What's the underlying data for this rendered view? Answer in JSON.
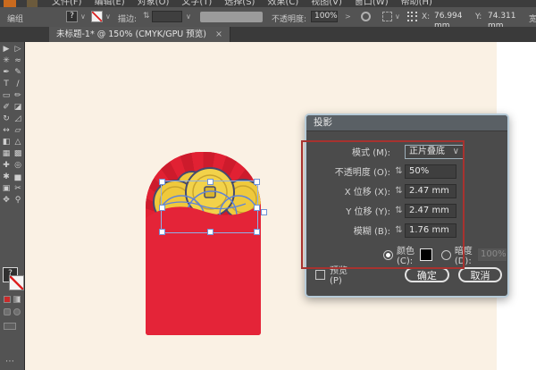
{
  "menu": {
    "items": [
      "文件(F)",
      "编辑(E)",
      "对象(O)",
      "文字(T)",
      "选择(S)",
      "效果(C)",
      "视图(V)",
      "窗口(W)",
      "帮助(H)"
    ]
  },
  "control_bar": {
    "group_label": "编组",
    "fill_mark": "?",
    "stroke_label": "描边:",
    "opacity_label": "不透明度:",
    "opacity_value": "100%",
    "opacity_more": ">",
    "x_label": "X:",
    "x_value": "76.994 mm",
    "y_label": "Y:",
    "y_value": "74.311 mm",
    "width_label": "宽:"
  },
  "tab_bar": {
    "tab_title": "未标题-1* @ 150% (CMYK/GPU 预览)",
    "close_glyph": "×"
  },
  "toolbar": {
    "fill_mark": "?",
    "more_glyph": "⋯",
    "tools": [
      {
        "name": "selection-tool",
        "glyph": "▶"
      },
      {
        "name": "direct-selection-tool",
        "glyph": "▷"
      },
      {
        "name": "magic-wand-tool",
        "glyph": "✳"
      },
      {
        "name": "lasso-tool",
        "glyph": "≈"
      },
      {
        "name": "pen-tool",
        "glyph": "✒"
      },
      {
        "name": "curvature-tool",
        "glyph": "✎"
      },
      {
        "name": "type-tool",
        "glyph": "T"
      },
      {
        "name": "line-segment-tool",
        "glyph": "∕"
      },
      {
        "name": "rectangle-tool",
        "glyph": "▭"
      },
      {
        "name": "paintbrush-tool",
        "glyph": "✏"
      },
      {
        "name": "shaper-tool",
        "glyph": "✐"
      },
      {
        "name": "eraser-tool",
        "glyph": "◪"
      },
      {
        "name": "rotate-tool",
        "glyph": "↻"
      },
      {
        "name": "scale-tool",
        "glyph": "◿"
      },
      {
        "name": "width-tool",
        "glyph": "↔"
      },
      {
        "name": "free-transform-tool",
        "glyph": "▱"
      },
      {
        "name": "shape-builder-tool",
        "glyph": "◧"
      },
      {
        "name": "perspective-grid-tool",
        "glyph": "△"
      },
      {
        "name": "mesh-tool",
        "glyph": "▦"
      },
      {
        "name": "gradient-tool",
        "glyph": "▩"
      },
      {
        "name": "eyedropper-tool",
        "glyph": "✚"
      },
      {
        "name": "blend-tool",
        "glyph": "◎"
      },
      {
        "name": "symbol-sprayer-tool",
        "glyph": "✱"
      },
      {
        "name": "graph-tool",
        "glyph": "▅"
      },
      {
        "name": "artboard-tool",
        "glyph": "▣"
      },
      {
        "name": "slice-tool",
        "glyph": "✂"
      },
      {
        "name": "hand-tool",
        "glyph": "✥"
      },
      {
        "name": "zoom-tool",
        "glyph": "⚲"
      }
    ]
  },
  "artwork": {
    "envelope_color": "#e12133",
    "ray_color": "#cd1b2c",
    "coin_color": "#efc93c",
    "coin_outline": "#454a6e",
    "selection_color": "#8fb0e8"
  },
  "annotation": {
    "color": "#a8322f"
  },
  "dialog": {
    "title": "投影",
    "rows": [
      {
        "label": "模式 (M):",
        "value": "正片叠底"
      },
      {
        "label": "不透明度 (O):",
        "value": "50%"
      },
      {
        "label": "X 位移 (X):",
        "value": "2.47 mm"
      },
      {
        "label": "Y 位移 (Y):",
        "value": "2.47 mm"
      },
      {
        "label": "模糊 (B):",
        "value": "1.76 mm"
      }
    ],
    "color_label": "颜色 (C):",
    "darkness_label": "暗度 (D):",
    "darkness_value": "100%",
    "preview_label": "预览 (P)",
    "ok_label": "确定",
    "cancel_label": "取消"
  },
  "ui": {
    "chevron_down": "∨",
    "stepper": "⇅"
  }
}
